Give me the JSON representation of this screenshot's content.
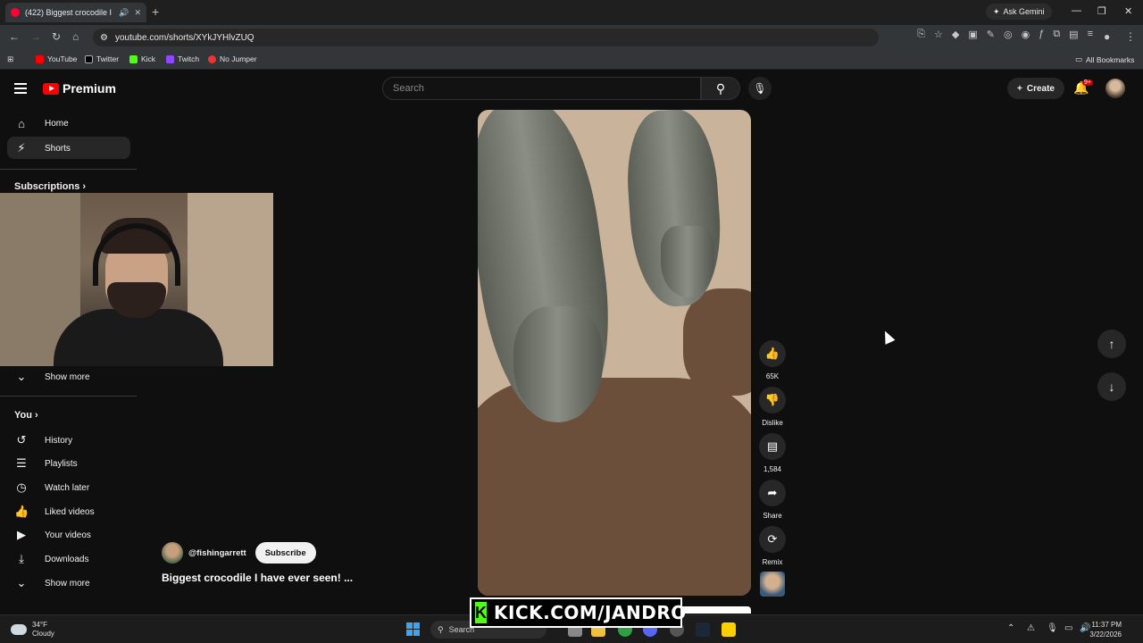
{
  "browser": {
    "tab_title": "(422) Biggest crocodile I ha",
    "url": "youtube.com/shorts/XYkJYHlvZUQ",
    "ask_gemini": "Ask Gemini",
    "bookmarks": [
      "YouTube",
      "Twitter",
      "Kick",
      "Twitch",
      "No Jumper"
    ],
    "all_bookmarks": "All Bookmarks"
  },
  "header": {
    "logo": "Premium",
    "search_placeholder": "Search",
    "create_label": "Create",
    "notif_badge": "9+"
  },
  "sidebar": {
    "items": [
      {
        "label": "Home",
        "icon": "home-icon"
      },
      {
        "label": "Shorts",
        "icon": "shorts-icon"
      }
    ],
    "subscriptions_heading": "Subscriptions",
    "show_more_1": "Show more",
    "you_heading": "You",
    "you_items": [
      {
        "label": "History",
        "icon": "history-icon"
      },
      {
        "label": "Playlists",
        "icon": "playlists-icon"
      },
      {
        "label": "Watch later",
        "icon": "watch-later-icon"
      },
      {
        "label": "Liked videos",
        "icon": "like-icon"
      },
      {
        "label": "Your videos",
        "icon": "your-videos-icon"
      },
      {
        "label": "Downloads",
        "icon": "download-icon"
      }
    ],
    "show_more_2": "Show more"
  },
  "short": {
    "channel": "@fishingarrett",
    "subscribe_label": "Subscribe",
    "title": "Biggest crocodile I have ever seen! ...",
    "likes": "65K",
    "dislike_label": "Dislike",
    "comments": "1,584",
    "share_label": "Share",
    "remix_label": "Remix"
  },
  "overlay": {
    "kick_text": "KICK.COM/JANDRO"
  },
  "taskbar": {
    "temp": "34°F",
    "condition": "Cloudy",
    "search_label": "Search",
    "time": "11:37 PM",
    "date": "3/22/2026"
  }
}
